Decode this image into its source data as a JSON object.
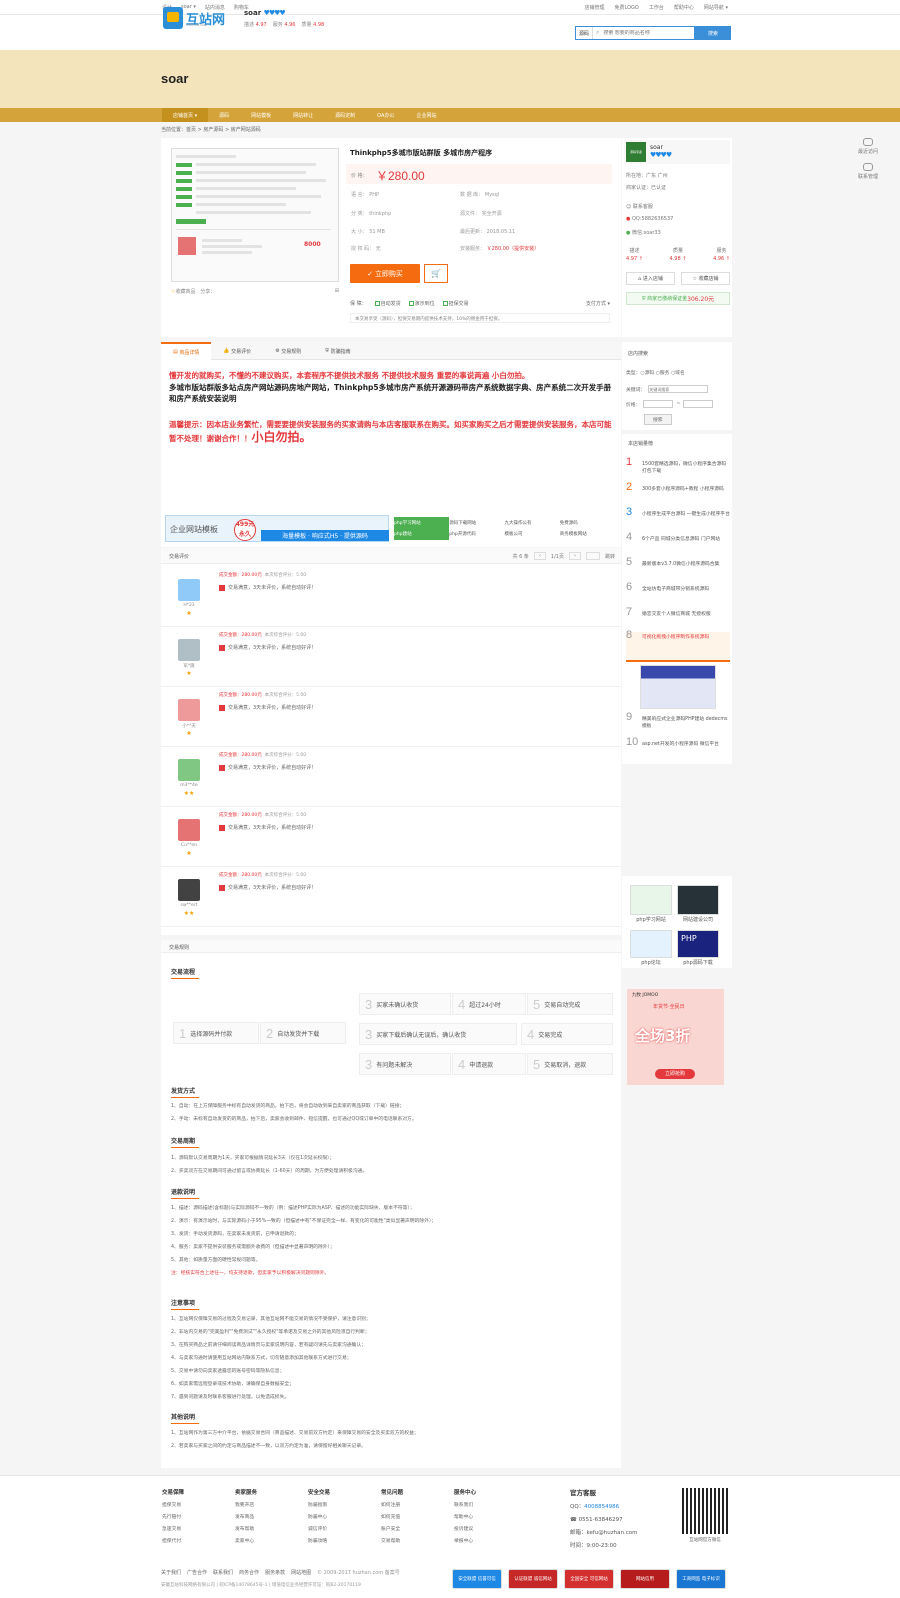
{
  "topbar": {
    "left": [
      "设计",
      "soar ▾",
      "站内消息",
      "购物车"
    ],
    "right": [
      "店铺管理",
      "免费LOGO",
      "工作台",
      "帮助中心",
      "网站导航 ▾"
    ]
  },
  "header": {
    "logo_text": "互站网",
    "logo_sub": "HUZHAN.COM",
    "shop_name": "soar",
    "shop_hearts": "♥♥♥♥",
    "stats": [
      {
        "label": "描述",
        "value": "4.97"
      },
      {
        "label": "服务",
        "value": "4.96"
      },
      {
        "label": "质量",
        "value": "4.98"
      }
    ],
    "search_scope": "源码",
    "search_placeholder": "搜索 想要的商品名称",
    "search_button": "搜索"
  },
  "banner": {
    "title": "soar"
  },
  "nav": [
    "店铺首页 ▾",
    "源码",
    "网站模板",
    "网站转让",
    "源码定制",
    "OA办公",
    "企业网站"
  ],
  "breadcrumb": "当前位置：首页 > 房产源码 > 房产网站源码",
  "product": {
    "title": "Thinkphp5多城市版站群版 多城市房产程序",
    "price_label": "价 格：",
    "price": "￥280.00",
    "attrs": [
      {
        "k": "语 言：",
        "v": "PHP"
      },
      {
        "k": "数 据 库：",
        "v": "Mysql"
      },
      {
        "k": "分 类：",
        "v": "thinkphp"
      },
      {
        "k": "源文件：",
        "v": "完全开源"
      },
      {
        "k": "大 小：",
        "v": "51 MB"
      },
      {
        "k": "最后更新：",
        "v": "2018.05.11"
      },
      {
        "k": "授 权 码：",
        "v": "无"
      },
      {
        "k": "安装服务：",
        "v": "￥280.00（提供安装）"
      }
    ],
    "buy_button": "立即购买",
    "cart_icon": "cart-icon",
    "thumb_actions": [
      "收藏商品",
      "分享："
    ],
    "guarantee_label": "保 障：",
    "guarantees": [
      "自动发货",
      "演示到位",
      "担保交易"
    ],
    "pay_label": "支付方式 ▾",
    "guarantee_note": "本交易享受（源码），担保交易期内提供技术支持，10%的佣金用于担保。"
  },
  "seller": {
    "name": "soar",
    "hearts": "♥♥♥♥",
    "avatar_text": "源码专卖",
    "lines": [
      "所在地：广东 广州",
      "商家认证：已认证",
      "联系客服",
      "QQ:5882636537",
      "微信:soar33"
    ],
    "scores": [
      {
        "label": "描述",
        "value": "4.97 ↑"
      },
      {
        "label": "质量",
        "value": "4.98 ↑"
      },
      {
        "label": "服务",
        "value": "4.96 ↑"
      }
    ],
    "buttons": [
      "进入店铺",
      "收藏店铺"
    ],
    "deposit_text": "商家已缴纳保证金",
    "deposit_amount": "306.20元"
  },
  "float": [
    "最近访问",
    "联系管理"
  ],
  "tabs": [
    "商品详情",
    "交易评价",
    "交易规则",
    "防骗指南"
  ],
  "description": {
    "red": "懂开发的就购买，不懂的不建议购买，本套程序不提供技术服务 不提供技术服务 重要的事说两遍 小白勿拍。",
    "black": "多城市版站群版多站点房产网站源码房地产网站，Thinkphp5多城市房产系统开源源码带房产系统数据字典、房产系统二次开发手册和房产系统安装说明",
    "red2": "温馨提示：因本店业务繁忙，需要要提供安装服务的买家请购与本店客服联系在购买。如买家购买之后才需要提供安装服务，本店可能暂不处理！谢谢合作！！",
    "red2_big": "小白勿拍。"
  },
  "ads": {
    "left_title": "企业网站模板",
    "left_badge": "499元 永久",
    "left_band": "海量模板 · 响应式H5 · 提供源码",
    "right": [
      "php学习网站",
      "源码下载网站",
      "九大操作公有",
      "免费源码",
      "php建站",
      "php开源代码",
      "模板公司",
      "商务模板网站"
    ]
  },
  "reviews": {
    "title": "交易评价",
    "pager": [
      "共 6 条",
      "1/1页",
      "跳转"
    ],
    "items": [
      {
        "name": "H*23",
        "stars": "★",
        "amount": "成交金额：280.00元",
        "score": "本次综合评分：5.00",
        "comment": "交易满意，3天未评价，系统自动好评！"
      },
      {
        "name": "军*旗",
        "stars": "★",
        "amount": "成交金额：280.00元",
        "score": "本次综合评分：5.00",
        "comment": "交易满意，3天未评价，系统自动好评！"
      },
      {
        "name": "小**天",
        "stars": "★",
        "amount": "成交金额：280.00元",
        "score": "本次综合评分：5.00",
        "comment": "交易满意，3天未评价，系统自动好评！"
      },
      {
        "name": "m3**4e",
        "stars": "★★",
        "amount": "成交金额：280.00元",
        "score": "本次综合评分：5.00",
        "comment": "交易满意，3天未评价，系统自动好评！"
      },
      {
        "name": "Cu**en",
        "stars": "★",
        "amount": "成交金额：280.00元",
        "score": "本次综合评分：5.00",
        "comment": "交易满意，3天未评价，系统自动好评！"
      },
      {
        "name": "sw**ert",
        "stars": "★★",
        "amount": "成交金额：280.00元",
        "score": "本次综合评分：5.00",
        "comment": "交易满意，3天未评价，系统自动好评！"
      }
    ]
  },
  "rules": {
    "title": "交易规则",
    "flow_title": "交易流程",
    "flow": {
      "s1": "选择源码并付款",
      "s2": "自动发货并下载",
      "top": [
        "买家未确认收货",
        "超过24小时",
        "交易自动完成"
      ],
      "mid": [
        "买家下载后确认无误后，确认收货",
        "交易完成"
      ],
      "bot": [
        "有问题未解决",
        "申请退款",
        "交易取消，退款"
      ]
    },
    "delivery_title": "发货方式",
    "delivery": [
      "1、自动：在上方保障服务中标有自动发货的商品，拍下后，将会自动收到来自卖家的商品获取（下载）链接；",
      "2、手动：未标有自动发货的的商品，拍下后，卖家会收到邮件、短信提醒，也可通过QQ或订单中的电话联系对方。"
    ],
    "cycle_title": "交易周期",
    "cycle": [
      "1、源码默认交易周期为1天，买家可根据情况延长3天（仅在1次延长权限）；",
      "2、买卖双方在交易期间可通过留言或协商延长（1-60天）的周期，为方便处理请积极沟通。"
    ],
    "refund_title": "退款说明",
    "refund": [
      "1、描述：源码描述(含标题)与实际源码不一致的（例：描述PHP实际为ASP、描述的功能实际缺失、版本不符等）；",
      "2、演示：有演示站时，与实际源码小于95%一致的（但描述中有\"不保证完全一样、有变化的可能性\"类似显著声明的除外）；",
      "3、发货：手动发货源码，在卖家未发货前，已申请退款的；",
      "4、服务：卖家不提供安装服务或需额外收费的（但描述中显著声明的除外）；",
      "5、其他：如质量方面的硬性常规问题等。",
      "注：经核实符合上述任一，均支持退款，但卖家予以积极解决问题则除外。"
    ],
    "notice_title": "注意事项",
    "notice": [
      "1、互站网仅保障交易的过程及交易记录，其他互站网不能交易的情况不受保护，请注意识别；",
      "2、非站内交易的\"完美盈利\"\"免费测试\"\"永久授权\"等承诺及交易之外的其他风险须自行判断；",
      "3、在购买商品之前请仔细阅读商品详情页与卖家说明内容，若有疑问请先与卖家沟通确认；",
      "4、与卖家沟通时请使用互站网站内联系方式，切勿随意添加其他联系方式进行交易；",
      "5、交易中请勿向卖家透露您的账号密码等隐私信息；",
      "6、如卖家需远程登录或技术协助，请确保自身数据安全；",
      "7、遇到问题请及时联系客服进行处理，以免造成损失。"
    ],
    "other_title": "其他说明",
    "other": [
      "1、互站网作为第三方中介平台，依据交易合同（商品描述、交易前双方约定）来保障交易的安全及买卖双方的权益；",
      "2、若卖家与买家之间的约定与商品描述不一致，以双方约定为准，请保留好相关聊天记录。"
    ]
  },
  "sidebar": {
    "search_title": "店内搜索",
    "search_rows": [
      "类型：○源码 ○服务 ○域名",
      "关键词：",
      "价格：",
      "搜索"
    ],
    "search_kw_placeholder": "关键词搜索",
    "rank_title": "本店销量榜",
    "ranks": [
      {
        "n": "1",
        "t": "1500套精选源码，微信小程序集合源码打包下载"
      },
      {
        "n": "2",
        "t": "300多套小程序源码+教程 小程序源码"
      },
      {
        "n": "3",
        "t": "小程序生成平台源码 一键生成小程序平台"
      },
      {
        "n": "4",
        "t": "6个产品 同城分类信息源码 门户网站"
      },
      {
        "n": "5",
        "t": "最新版本v3.7.0微信小程序源码合集"
      },
      {
        "n": "6",
        "t": "全站仿电子商城带分销系统源码"
      },
      {
        "n": "7",
        "t": "婚恋交友个人微信商城 无授权版"
      },
      {
        "n": "8",
        "t": "可视化拖拽小程序制作系统源码"
      },
      {
        "n": "9",
        "t": "精美响应式企业源码PHP建站 dedecms模板"
      },
      {
        "n": "10",
        "t": "asp.net开发的小程序源码 微信平台"
      }
    ],
    "small_ads": [
      "php学习网站",
      "网站建设公司",
      "php论坛",
      "php源码下载"
    ],
    "jomoo_brand": "九牧 JOMOO",
    "jomoo_tag": "年货节·全民日",
    "jomoo_main": "全场3折",
    "jomoo_btn": "立即抢购"
  },
  "footer": {
    "cols": [
      {
        "title": "交易保障",
        "items": [
          "担保交易",
          "先行赔付",
          "急速交易",
          "担保代付"
        ]
      },
      {
        "title": "卖家服务",
        "items": [
          "我要开店",
          "发布商品",
          "发布帮助",
          "卖家中心"
        ]
      },
      {
        "title": "安全交易",
        "items": [
          "防骗指南",
          "防骗中心",
          "诚信评价",
          "防骗攻略"
        ]
      },
      {
        "title": "常见问题",
        "items": [
          "如何注册",
          "如何充值",
          "账户安全",
          "交易帮助"
        ]
      },
      {
        "title": "服务中心",
        "items": [
          "联系我们",
          "帮助中心",
          "投诉建议",
          "举报中心"
        ]
      }
    ],
    "contact_title": "官方客服",
    "qq_label": "QQ：",
    "qq": "4008854986",
    "phone": "0551-63846297",
    "email": "邮箱：kefu@huzhan.com",
    "time": "时间：9:00-23:00",
    "qr_label": "互站网官方微信",
    "links": [
      "关于我们",
      "广告合作",
      "联系我们",
      "商务合作",
      "服务条款",
      "网站地图"
    ],
    "copyright_inline": "© 2009-2017 huzhan.com 备案号",
    "copyright": "安徽互站科技网络有限公司 | 皖ICP备14078645号-1 | 增值电信业务经营许可证：皖B2-20170119",
    "certs": [
      "安全联盟 信誉可信",
      "认证联盟 诚信网站",
      "全国安全 可信网站",
      "网站信用",
      "工商网监 电子标识"
    ]
  }
}
